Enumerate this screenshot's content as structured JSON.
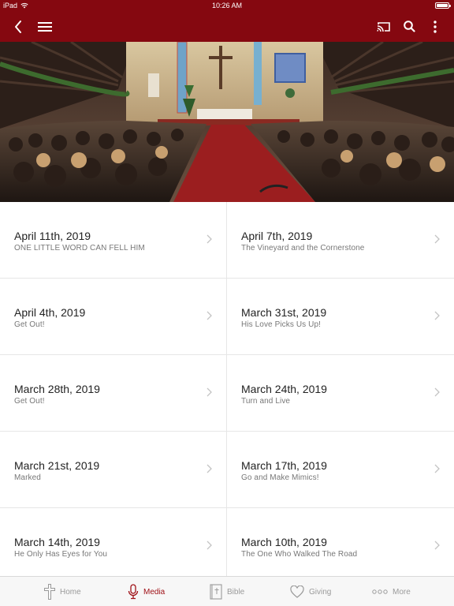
{
  "status": {
    "device": "iPad",
    "time": "10:26 AM",
    "battery_level": 1.0
  },
  "nav": {
    "icons": [
      "back-icon",
      "menu-icon",
      "cast-icon",
      "search-icon",
      "more-vertical-icon"
    ]
  },
  "colors": {
    "brand": "#850810",
    "accent": "#a01218",
    "tab_inactive": "#9a9a9a"
  },
  "sermons": [
    {
      "date": "April 11th, 2019",
      "title": "ONE LITTLE WORD CAN FELL HIM"
    },
    {
      "date": "April 7th, 2019",
      "title": "The Vineyard and the Cornerstone"
    },
    {
      "date": "April 4th, 2019",
      "title": "Get Out!"
    },
    {
      "date": "March 31st, 2019",
      "title": "His Love Picks Us Up!"
    },
    {
      "date": "March 28th, 2019",
      "title": "Get Out!"
    },
    {
      "date": "March 24th, 2019",
      "title": "Turn and Live"
    },
    {
      "date": "March 21st, 2019",
      "title": "Marked"
    },
    {
      "date": "March 17th, 2019",
      "title": "Go and Make Mimics!"
    },
    {
      "date": "March 14th, 2019",
      "title": "He Only Has Eyes for You"
    },
    {
      "date": "March 10th, 2019",
      "title": "The One Who Walked The Road"
    }
  ],
  "tabs": [
    {
      "label": "Home",
      "icon": "cross-icon",
      "active": false
    },
    {
      "label": "Media",
      "icon": "microphone-icon",
      "active": true
    },
    {
      "label": "Bible",
      "icon": "bible-icon",
      "active": false
    },
    {
      "label": "Giving",
      "icon": "heart-icon",
      "active": false
    },
    {
      "label": "More",
      "icon": "more-dots-icon",
      "active": false
    }
  ]
}
